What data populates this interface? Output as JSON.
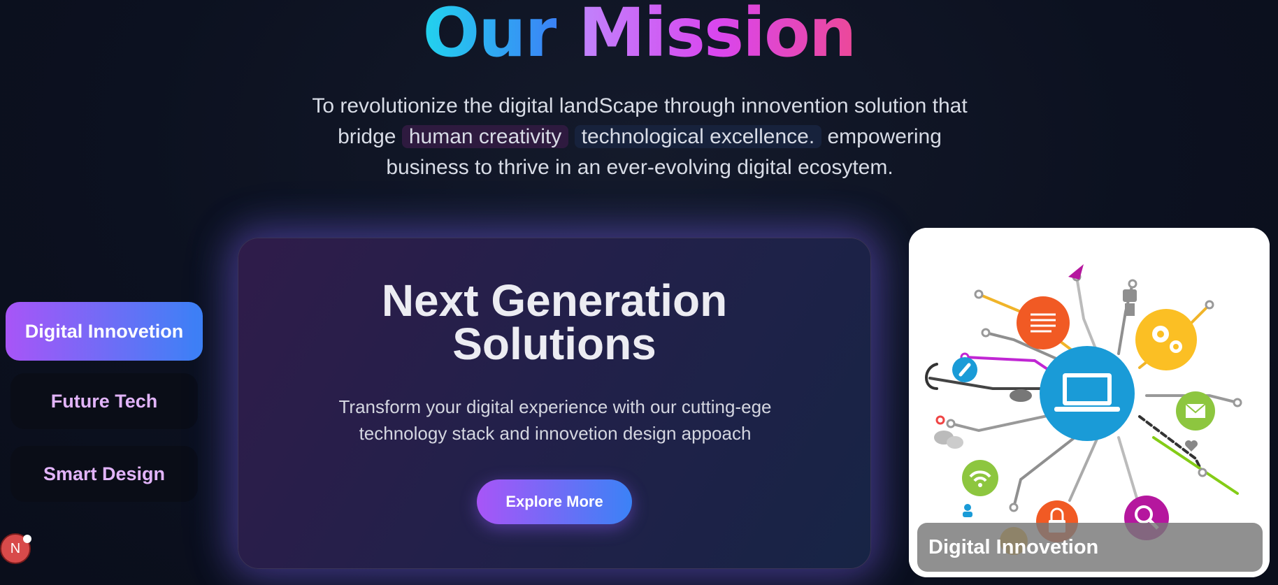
{
  "mission": {
    "title_part1": "Our",
    "title_part2": "Mission",
    "text_line1": "To revolutionize the digital landScape through innovention solution that",
    "text_bridge": "bridge",
    "highlight1": "human creativity",
    "highlight2": "technological excellence.",
    "text_after": "empowering",
    "text_line3": "business to thrive in an ever-evolving digital ecosytem."
  },
  "sidenav": {
    "items": [
      {
        "label": "Digital Innovetion",
        "active": true
      },
      {
        "label": "Future Tech",
        "active": false
      },
      {
        "label": "Smart Design",
        "active": false
      }
    ]
  },
  "hero": {
    "title_line1": "Next Generation",
    "title_line2": "Solutions",
    "desc_line1": "Transform your digital experience with our cutting-ege",
    "desc_line2": "technology stack and innovetion design appoach",
    "button": "Explore More"
  },
  "image_card": {
    "caption": "Digital Innovetion",
    "illustration": "laptop-network-icon"
  },
  "dev_badge": {
    "letter": "N"
  },
  "colors": {
    "background": "#0c1120",
    "accent_purple": "#a855f7",
    "accent_blue": "#3b82f6",
    "title_cyan": "#22d3ee",
    "title_pink": "#ec4899",
    "nav_inactive_text": "#e2b4fb"
  }
}
